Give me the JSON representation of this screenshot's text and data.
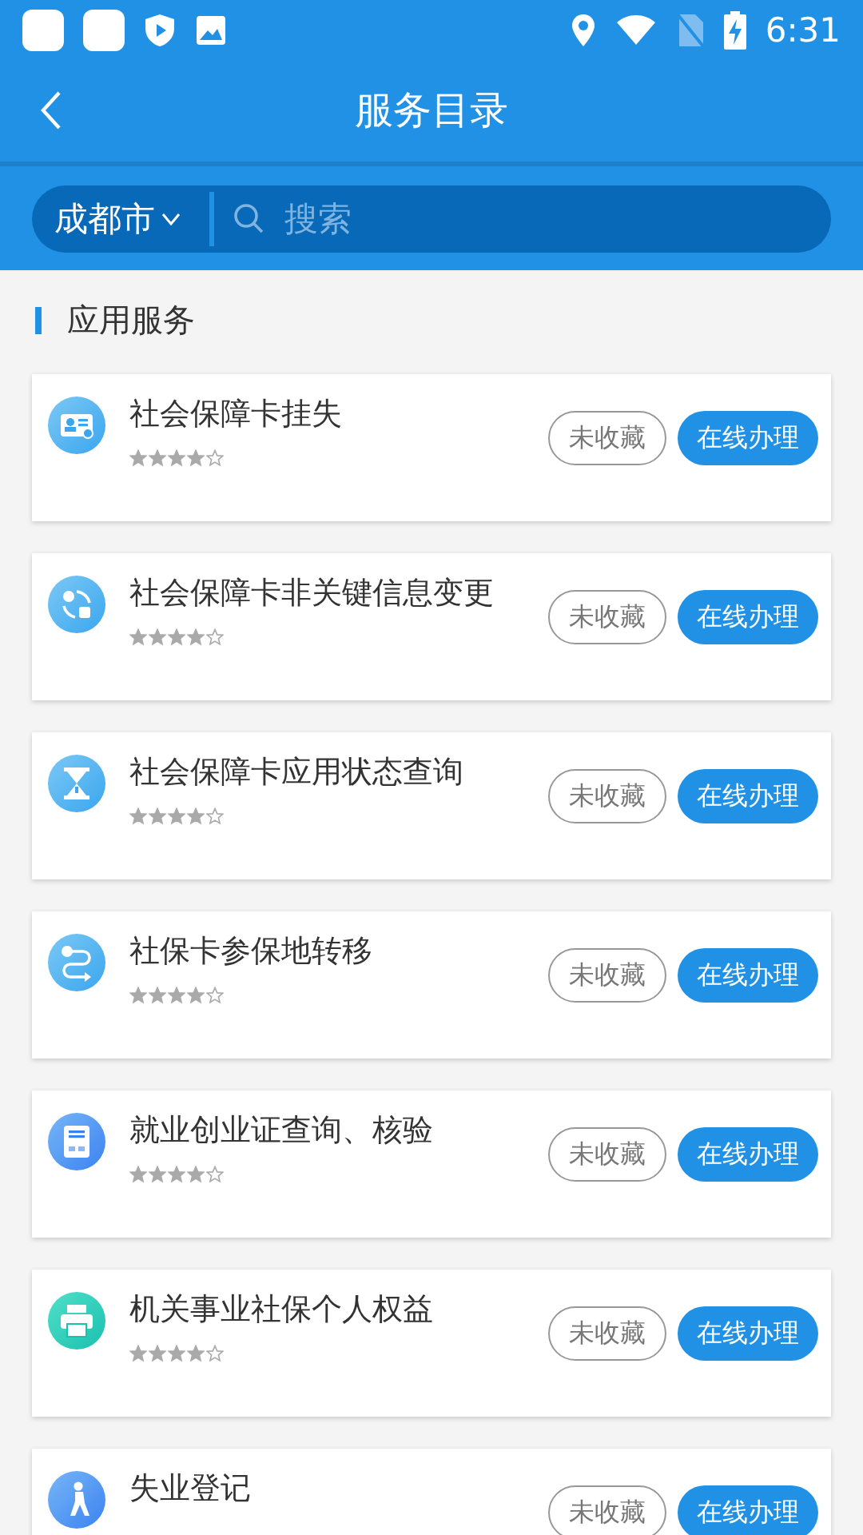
{
  "status_bar": {
    "time": "6:31"
  },
  "header": {
    "title": "服务目录"
  },
  "search": {
    "city": "成都市",
    "placeholder": "搜索"
  },
  "section": {
    "title": "应用服务"
  },
  "services": [
    {
      "kind": "card",
      "title": "社会保障卡挂失",
      "stars": 4,
      "favorited": false,
      "favorite_label": "未收藏",
      "action": "在线办理"
    },
    {
      "kind": "sync",
      "title": "社会保障卡非关键信息变更",
      "stars": 4,
      "favorited": false,
      "favorite_label": "未收藏",
      "action": "在线办理"
    },
    {
      "kind": "hourglass",
      "title": "社会保障卡应用状态查询",
      "stars": 4,
      "favorited": false,
      "favorite_label": "未收藏",
      "action": "在线办理"
    },
    {
      "kind": "route",
      "title": "社保卡参保地转移",
      "stars": 4,
      "favorited": false,
      "favorite_label": "未收藏",
      "action": "在线办理"
    },
    {
      "kind": "document",
      "title": "就业创业证查询、核验",
      "stars": 4,
      "favorited": false,
      "favorite_label": "未收藏",
      "action": "在线办理"
    },
    {
      "kind": "printer",
      "title": "机关事业社保个人权益",
      "stars": 4,
      "favorited": false,
      "favorite_label": "未收藏",
      "action": "在线办理"
    },
    {
      "kind": "runner",
      "title": "失业登记",
      "favorited": false,
      "favorite_label": "未收藏",
      "action": "在线办理"
    }
  ]
}
